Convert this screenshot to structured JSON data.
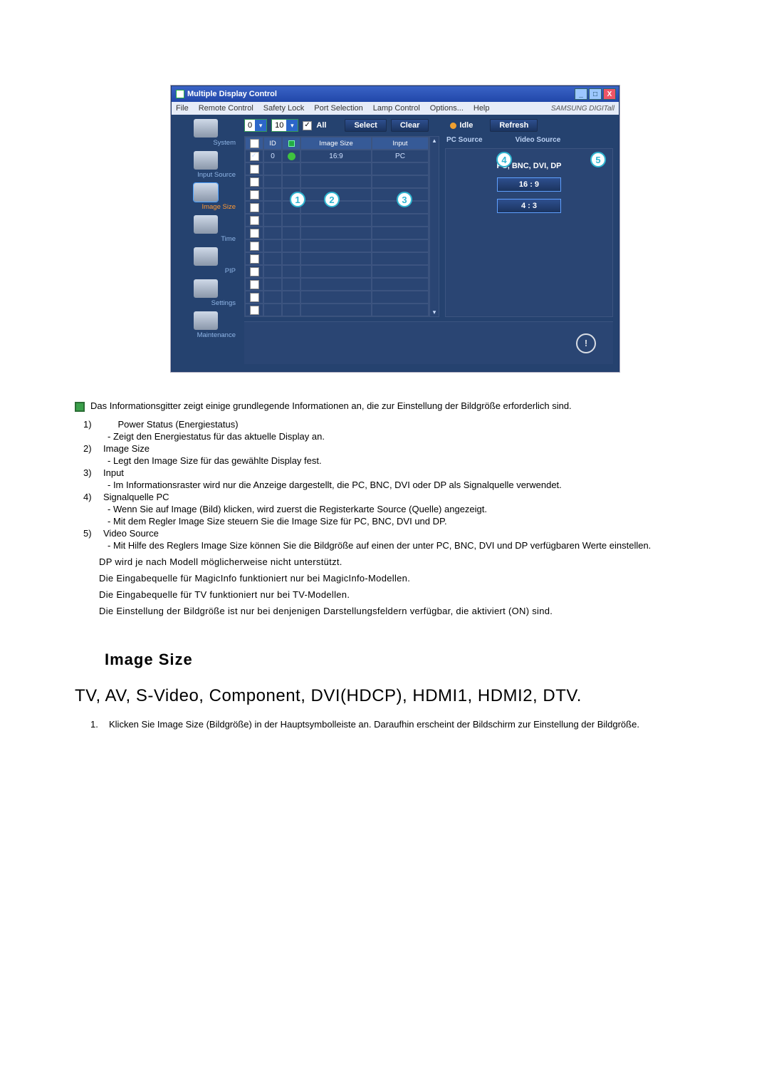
{
  "window": {
    "title": "Multiple Display Control",
    "menus": [
      "File",
      "Remote Control",
      "Safety Lock",
      "Port Selection",
      "Lamp Control",
      "Options...",
      "Help"
    ],
    "brand": "SAMSUNG DIGITall"
  },
  "sidebar": {
    "items": [
      {
        "label": "System"
      },
      {
        "label": "Input Source"
      },
      {
        "label": "Image Size",
        "selected": true
      },
      {
        "label": "Time"
      },
      {
        "label": "PIP"
      },
      {
        "label": "Settings"
      },
      {
        "label": "Maintenance"
      }
    ]
  },
  "toolbar": {
    "dd1": "0",
    "dd2": "10",
    "all": "All",
    "select": "Select",
    "clear": "Clear",
    "idle": "Idle",
    "refresh": "Refresh"
  },
  "grid": {
    "headers": {
      "id": "ID",
      "size": "Image Size",
      "input": "Input"
    },
    "row": {
      "id": "0",
      "size": "16:9",
      "input": "PC"
    }
  },
  "panel": {
    "tab_pc": "PC Source",
    "tab_video": "Video Source",
    "title": "PC, BNC, DVI, DP",
    "ratio1": "16 : 9",
    "ratio2": "4 : 3"
  },
  "callouts": [
    "1",
    "2",
    "3",
    "4",
    "5"
  ],
  "doc": {
    "lead": "Das Informationsgitter zeigt einige grundlegende Informationen an, die zur Einstellung der Bildgröße erforderlich sind.",
    "i1_num": "1)",
    "i1_title": "Power Status (Energiestatus)",
    "i1_sub": "- Zeigt den Energiestatus für das aktuelle Display an.",
    "i2_num": "2)",
    "i2_title": "Image Size",
    "i2_sub": "- Legt den Image Size für das gewählte Display fest.",
    "i3_num": "3)",
    "i3_title": "Input",
    "i3_sub": "- Im Informationsraster wird nur die Anzeige dargestellt, die PC, BNC, DVI oder DP als Signalquelle verwendet.",
    "i4_num": "4)",
    "i4_title": "Signalquelle PC",
    "i4_sub1": "- Wenn Sie auf Image (Bild) klicken, wird zuerst die Registerkarte Source (Quelle) angezeigt.",
    "i4_sub2": "- Mit dem Regler Image Size steuern Sie die Image Size für PC, BNC, DVI und DP.",
    "i5_num": "5)",
    "i5_title": "Video Source",
    "i5_sub": "- Mit Hilfe des Reglers Image Size können Sie die Bildgröße auf einen der unter PC, BNC, DVI und DP verfügbaren Werte einstellen.",
    "note1": "DP wird je nach Modell möglicherweise nicht unterstützt.",
    "note2": "Die Eingabequelle für MagicInfo funktioniert nur bei MagicInfo-Modellen.",
    "note3": "Die Eingabequelle für TV funktioniert nur bei TV-Modellen.",
    "note4": "Die Einstellung der Bildgröße ist nur bei denjenigen Darstellungsfeldern verfügbar, die aktiviert (ON) sind.",
    "h2": "Image Size",
    "h1": "TV, AV, S-Video, Component, DVI(HDCP), HDMI1, HDMI2, DTV.",
    "final_num": "1.",
    "final": "Klicken Sie Image Size (Bildgröße) in der Hauptsymbolleiste an. Daraufhin erscheint der Bildschirm zur Einstellung der Bildgröße."
  }
}
